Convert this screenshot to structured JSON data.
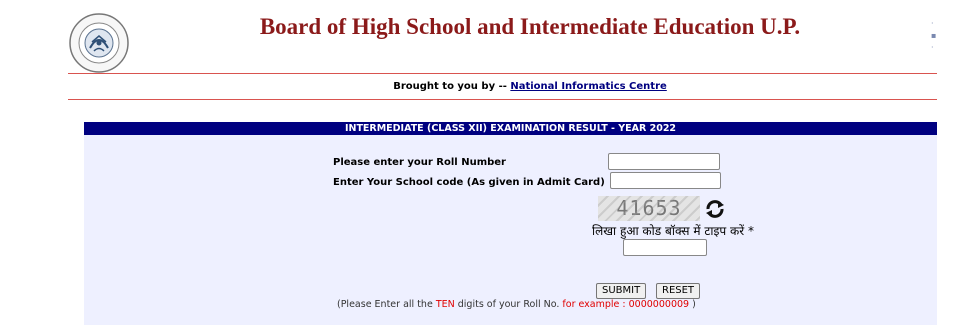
{
  "header": {
    "title": "Board of High School and Intermediate Education U.P.",
    "logo_icon": "up-government-emblem-icon"
  },
  "credit": {
    "prefix": "Brought to you by -- ",
    "link": "National Informatics Centre"
  },
  "form": {
    "heading": "INTERMEDIATE (CLASS XII)  EXAMINATION RESULT - YEAR 2022",
    "roll_label": "Please enter your Roll Number",
    "roll_value": "",
    "school_label": "Enter Your School code (As given in Admit Card)",
    "school_value": "",
    "captcha_text": "41653",
    "captcha_hint": "लिखा हुआ कोड बॉक्स में टाइप करें *",
    "captcha_value": "",
    "submit_label": "SUBMIT",
    "reset_label": "RESET",
    "note_open": "(Please Enter all the ",
    "note_ten": "TEN",
    "note_mid": " digits of your Roll No. ",
    "note_example": "for example : 0000000009",
    "note_close": " )"
  },
  "colors": {
    "title": "#8b1a1a",
    "panel_header": "#000080",
    "panel_bg": "#eef0ff",
    "rule": "#d9534f",
    "note_red": "#e00000"
  }
}
